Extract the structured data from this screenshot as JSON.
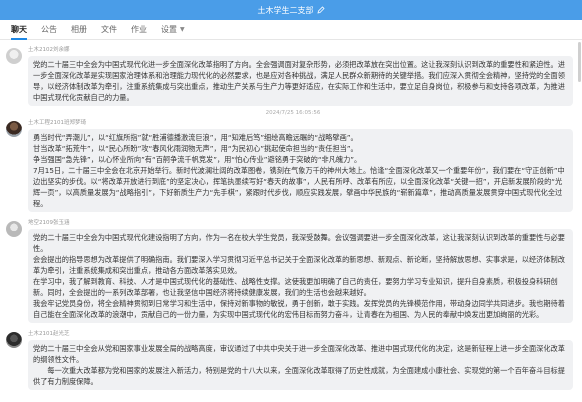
{
  "window": {
    "title": "土木学生二支部",
    "edit_icon": "pencil-icon"
  },
  "tabs": [
    {
      "label": "聊天",
      "active": true
    },
    {
      "label": "公告"
    },
    {
      "label": "相册"
    },
    {
      "label": "文件"
    },
    {
      "label": "作业"
    },
    {
      "label": "设置"
    }
  ],
  "messages": [
    {
      "sender": "土木2102刘余娜",
      "paragraphs": [
        "党的二十届三中全会为中国式现代化进一步全面深化改革指明了方向。全会强调面对复杂形势，必须把改革放在突出位置。这让我深刻认识到改革的重要性和紧迫性。进一步全面深化改革是实现国家治理体系和治理能力现代化的必然要求，也是应对各种挑战，满足人民群众新期待的关键举措。我们应深入贯彻全会精神，坚持党的全面领导，以经济体制改革为牵引，注重系统集成与突出重点，推动生产关系与生产力等更好适应，在实际工作和生活中，要立足自身岗位，积极参与和支持各项改革，为推进中国式现代化贡献自己的力量。"
      ]
    },
    {
      "timestamp": "2024/7/25 16:05:56"
    },
    {
      "sender": "土木工程2101班郑梦琦",
      "paragraphs": [
        "勇当时代“弄潮儿”，以“红旗所指”就“胜浦德播激流巨浪”，用“知难后笃”细绘高瞻远瞩的“战略擘画”。",
        "甘当改革“拓荒牛”，以“民心所盼”攻“春风化雨润物无声”，用“为民初心”挑起使命担当的“责任担当”。",
        "争当强国“急先锋”，以心怀业所向”有“百舸争流千帆竞发”，用“怕心传业”避铭勇于突破的“非凡魄力”。",
        "7月15日，二十届三中全会在北京开始举行。新时代波澜壮阔的改革图卷，镌刻在气象万千的神州大地上。恰逢“全面深化改革又一个重要年份”，我们要在“守正创新”中边出坚实的步伐。以“将改革开放进行到底”的坚定决心，挥笔执墨续写好“春天的故事”，人民有所呼、改革有所应，以全面深化改革“关键一招”，开启新发展阶段的“光辉一页”，以高质量发展为“战略指引”，下好新质生产力“先手棋”，紧跟时代步伐，顺应实践发展，擘画中华民族的“崭新篇章”，推动高质量发展贯穿中国式现代化全过程。"
      ]
    },
    {
      "sender": "地空2109张玉涵",
      "paragraphs": [
        "党的二十届三中全会为中国式现代化建设指明了方向，作为一名在校大学生党员，我深受鼓舞。会议强调要进一步全面深化改革，这让我深刻认识到改革的重要性与必要性。",
        "会会提出的指导思想为改革提供了明确指南。我们要深入学习贯彻习近平总书记关于全面深化改革的新思想、新观点、新论断，坚持解放思想、实事求是，以经济体制改革为牵引，注重系统集成和突出重点，推动各方面改革落实见效。",
        "在学习中，我了解到教育、科技、人才是中国式现代化的基础性、战略性支撑。这使我更加明确了自己的责任，要努力学习专业知识，提升自身素质，积极投身科研创新。同时，全会提出的一系列改革部署，也让我坚信中国经济将持续健康发展，我们的生活也会越来越好。",
        "我会牢记党员身份，将全会精神贯彻到日常学习和生活中，保持对新事物的敏锐，勇于创新，敢于实践。发挥党员的先锋模范作用，带动身边同学共同进步。我也期待着自己能在全面深化改革的浪潮中，贡献自己的一份力量，为实现中国式现代化的宏伟目标而努力奋斗，让青春在为祖国、为人民的奉献中焕发出更加绚丽的光彩。"
      ]
    },
    {
      "sender": "土木2101赵光芝",
      "paragraphs": [
        "党的二十届三中全会从党和国家事业发展全局的战略高度，审议通过了中共中央关于进一步全面深化改革、推进中国式现代化的决定，这是新征程上进一步全面深化改革的纲领性文件。",
        "　　每一次重大改革都为党和国家的发展注入新活力，特别是党的十八大以来，全面深化改革取得了历史性成就，为全面建成小康社会、实现党的第一个百年奋斗目标提供了有力制度保障。"
      ]
    }
  ]
}
